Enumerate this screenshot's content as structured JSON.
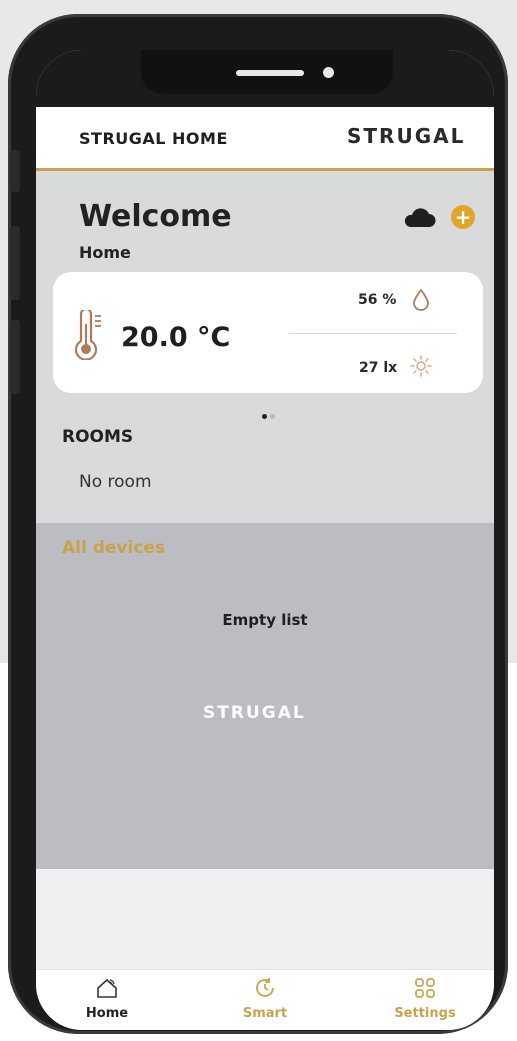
{
  "header": {
    "title": "STRUGAL HOME",
    "logo_text": "STRUGAL"
  },
  "welcome": {
    "title": "Welcome",
    "subtitle": "Home"
  },
  "icons": {
    "cloud": "cloud-icon",
    "add": "plus-circle-icon",
    "thermometer": "thermometer-icon",
    "humidity": "droplet-icon",
    "light": "sun-icon",
    "home": "home-icon",
    "smart": "refresh-clock-icon",
    "settings": "grid-icon"
  },
  "sensors": {
    "temperature": "20.0 °C",
    "humidity": "56 %",
    "light": "27 lx"
  },
  "pager": {
    "pages": 2,
    "active": 0
  },
  "rooms": {
    "title": "ROOMS",
    "empty": "No room"
  },
  "devices": {
    "title": "All devices",
    "empty": "Empty list",
    "logo_text": "STRUGAL"
  },
  "tabs": [
    {
      "label": "Home",
      "active": true
    },
    {
      "label": "Smart",
      "active": false
    },
    {
      "label": "Settings",
      "active": false
    }
  ],
  "colors": {
    "accent": "#c9a24a",
    "add_button": "#e2a528",
    "active_tab": "#222222"
  }
}
